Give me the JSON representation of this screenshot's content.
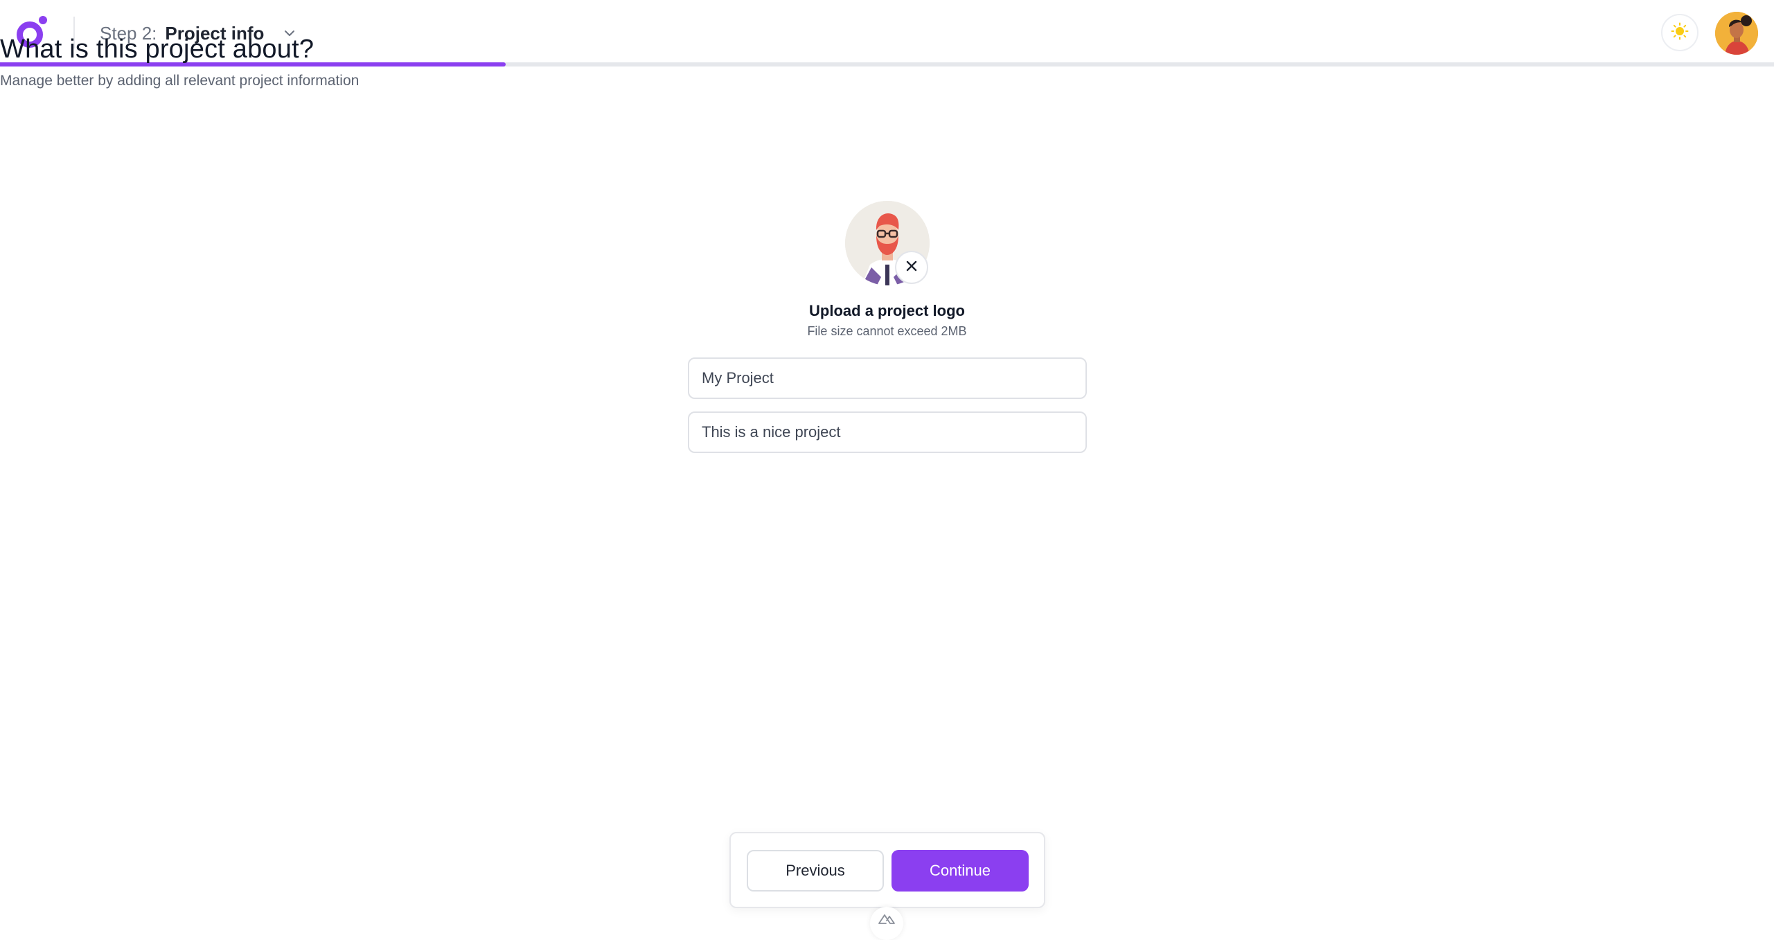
{
  "header": {
    "step_prefix": "Step 2:",
    "step_title": "Project info",
    "progress_percent": 28.5
  },
  "main": {
    "title": "What is this project about?",
    "subtitle": "Manage better by adding all relevant project information",
    "upload_label": "Upload a project logo",
    "upload_hint": "File size cannot exceed 2MB",
    "project_name_value": "My Project",
    "project_description_value": "This is a nice project"
  },
  "footer": {
    "previous_label": "Previous",
    "continue_label": "Continue"
  },
  "colors": {
    "accent": "#8b3ff0",
    "track": "#e5e7eb",
    "sun": "#facc15"
  },
  "icons": [
    "app-logo-icon",
    "chevron-down-icon",
    "sun-icon",
    "close-icon",
    "nuxt-icon"
  ]
}
